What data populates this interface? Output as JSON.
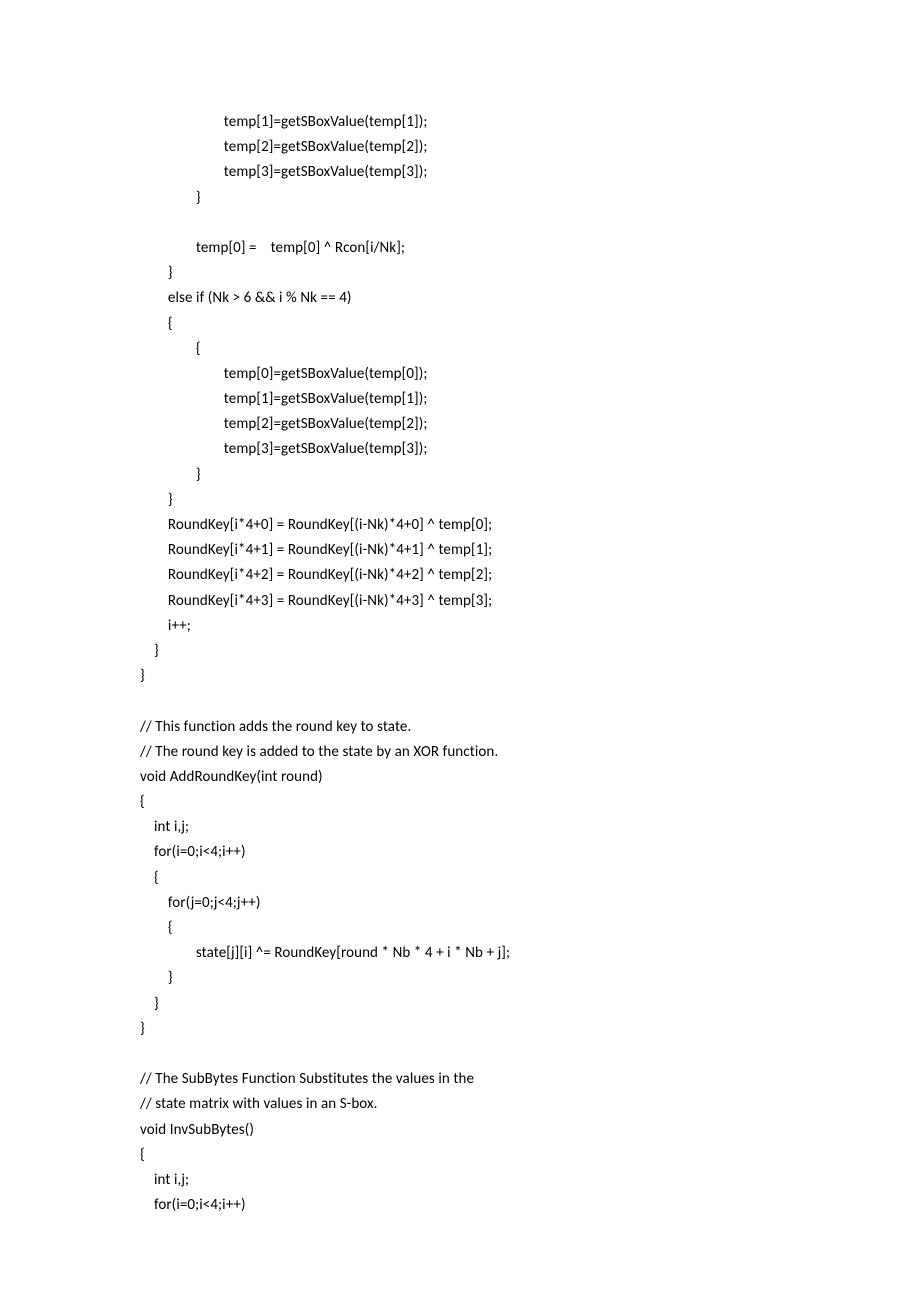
{
  "lines": [
    "                        temp[1]=getSBoxValue(temp[1]);",
    "                        temp[2]=getSBoxValue(temp[2]);",
    "                        temp[3]=getSBoxValue(temp[3]);",
    "                }",
    "",
    "                temp[0] =    temp[0] ^ Rcon[i/Nk];",
    "        }",
    "        else if (Nk > 6 && i % Nk == 4)",
    "        {",
    "                {",
    "                        temp[0]=getSBoxValue(temp[0]);",
    "                        temp[1]=getSBoxValue(temp[1]);",
    "                        temp[2]=getSBoxValue(temp[2]);",
    "                        temp[3]=getSBoxValue(temp[3]);",
    "                }",
    "        }",
    "        RoundKey[i*4+0] = RoundKey[(i-Nk)*4+0] ^ temp[0];",
    "        RoundKey[i*4+1] = RoundKey[(i-Nk)*4+1] ^ temp[1];",
    "        RoundKey[i*4+2] = RoundKey[(i-Nk)*4+2] ^ temp[2];",
    "        RoundKey[i*4+3] = RoundKey[(i-Nk)*4+3] ^ temp[3];",
    "        i++;",
    "    }",
    "}",
    "",
    "// This function adds the round key to state.",
    "// The round key is added to the state by an XOR function.",
    "void AddRoundKey(int round)",
    "{",
    "    int i,j;",
    "    for(i=0;i<4;i++)",
    "    {",
    "        for(j=0;j<4;j++)",
    "        {",
    "                state[j][i] ^= RoundKey[round * Nb * 4 + i * Nb + j];",
    "        }",
    "    }",
    "}",
    "",
    "// The SubBytes Function Substitutes the values in the",
    "// state matrix with values in an S-box.",
    "void InvSubBytes()",
    "{",
    "    int i,j;",
    "    for(i=0;i<4;i++)"
  ]
}
